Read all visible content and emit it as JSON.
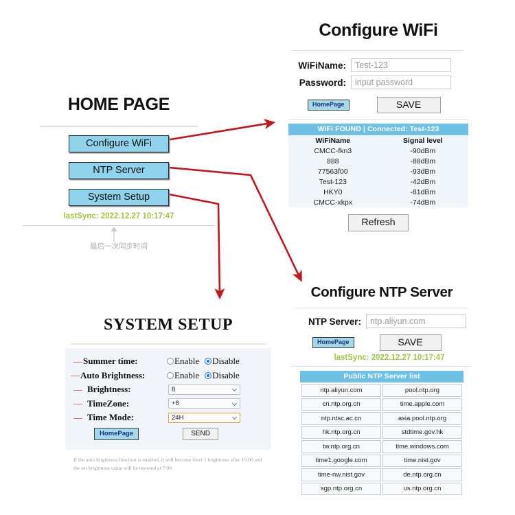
{
  "colors": {
    "accent_blue": "#8fd3ec",
    "table_header_blue": "#6ec1e4",
    "homepage_button_blue": "#a5d9ea",
    "arrow_red": "#c4161c",
    "dot_red": "#e8121a",
    "sync_green": "#9fc53d",
    "radio_selected": "#1a73e8",
    "select_focus_border": "#d9a03c",
    "panel_bg": "#f1f4f9"
  },
  "home_page": {
    "title": "HOME PAGE",
    "buttons": [
      {
        "label": "Configure WiFi"
      },
      {
        "label": "NTP Server"
      },
      {
        "label": "System Setup"
      }
    ],
    "last_sync": "lastSync: 2022.12.27 10:17:47",
    "annotation": "最后一次同步时间"
  },
  "configure_wifi": {
    "title": "Configure WiFi",
    "fields": [
      {
        "label": "WiFiName:",
        "value": "Test-123",
        "placeholder": "Test-123"
      },
      {
        "label": "Password:",
        "value": "",
        "placeholder": "input password"
      }
    ],
    "home_button": "HomePage",
    "save_button": "SAVE",
    "table_header": "WiFi FOUND  |  Connected: Test-123",
    "columns": [
      "WiFiName",
      "Signal level"
    ],
    "rows": [
      [
        "CMCC-fkn3",
        "-90dBm"
      ],
      [
        "888",
        "-88dBm"
      ],
      [
        "77563f00",
        "-93dBm"
      ],
      [
        "Test-123",
        "-42dBm"
      ],
      [
        "HKY0",
        "-81dBm"
      ],
      [
        "CMCC-xkpx",
        "-74dBm"
      ]
    ],
    "refresh_button": "Refresh"
  },
  "configure_ntp": {
    "title": "Configure NTP Server",
    "field_label": "NTP Server:",
    "field_value": "ntp.aliyun.com",
    "field_placeholder": "ntp.aliyun.com",
    "home_button": "HomePage",
    "save_button": "SAVE",
    "last_sync": "lastSync: 2022.12.27 10:17:47",
    "list_header": "Public NTP Server list",
    "list_rows": [
      [
        "ntp.aliyun.com",
        "pool.ntp.org"
      ],
      [
        "cn.ntp.org.cn",
        "time.apple.com"
      ],
      [
        "ntp.ntsc.ac.cn",
        "asia.pool.ntp.org"
      ],
      [
        "hk.ntp.org.cn",
        "stdtime.gov.hk"
      ],
      [
        "tw.ntp.org.cn",
        "time.windows.com"
      ],
      [
        "time1.google.com",
        "time.nist.gov"
      ],
      [
        "time-nw.nist.gov",
        "de.ntp.org.cn"
      ],
      [
        "sgp.ntp.org.cn",
        "us.ntp.org.cn"
      ]
    ]
  },
  "system_setup": {
    "title": "SYSTEM SETUP",
    "rows": [
      {
        "label": "Summer time:",
        "type": "radio",
        "options": [
          "Enable",
          "Disable"
        ],
        "selected": "Disable"
      },
      {
        "label": "Auto Brightness:",
        "type": "radio",
        "options": [
          "Enable",
          "Disable"
        ],
        "selected": "Disable"
      },
      {
        "label": "Brightness:",
        "type": "select",
        "value": "8"
      },
      {
        "label": "TimeZone:",
        "type": "select",
        "value": "+8"
      },
      {
        "label": "Time Mode:",
        "type": "select",
        "value": "24H",
        "focused": true
      }
    ],
    "home_button": "HomePage",
    "send_button": "SEND",
    "note": "If the auto brightness function is enabled, it will become level 1 brightness after 19:00.and the set brightness value will be restored at 7:00"
  }
}
